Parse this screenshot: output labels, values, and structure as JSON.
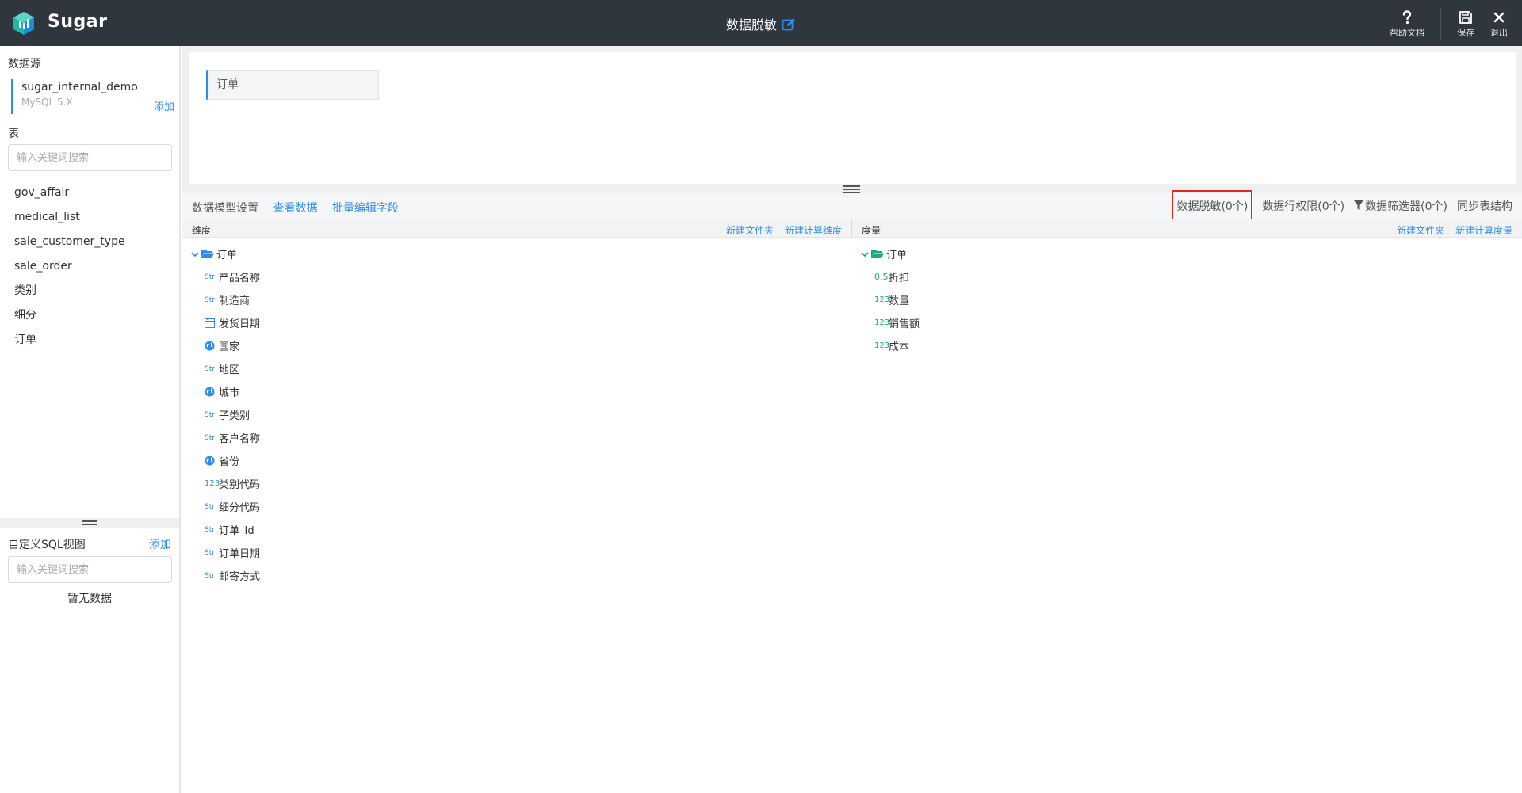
{
  "app": {
    "brand": "Sugar",
    "title": "数据脱敏"
  },
  "top_actions": {
    "help": "帮助文档",
    "save": "保存",
    "exit": "退出"
  },
  "sidebar": {
    "datasource_label": "数据源",
    "datasource": {
      "name": "sugar_internal_demo",
      "type": "MySQL 5.X",
      "add": "添加"
    },
    "tables_label": "表",
    "search_placeholder": "输入关键词搜索",
    "tables": [
      "gov_affair",
      "medical_list",
      "sale_customer_type",
      "sale_order",
      "类别",
      "细分",
      "订单"
    ],
    "sql_label": "自定义SQL视图",
    "sql_add": "添加",
    "sql_search_placeholder": "输入关键词搜索",
    "empty": "暂无数据"
  },
  "canvas": {
    "table_chip": "订单"
  },
  "toolbar": {
    "model_settings": "数据模型设置",
    "view_data": "查看数据",
    "batch_edit": "批量编辑字段",
    "masking": "数据脱敏(0个)",
    "row_permission": "数据行权限(0个)",
    "filter": "数据筛选器(0个)",
    "sync": "同步表结构"
  },
  "dimensions": {
    "header": "维度",
    "new_folder": "新建文件夹",
    "new_calc": "新建计算维度",
    "folder": "订单",
    "fields": [
      {
        "type": "Str",
        "name": "产品名称"
      },
      {
        "type": "Str",
        "name": "制造商"
      },
      {
        "type": "date",
        "name": "发货日期"
      },
      {
        "type": "geo",
        "name": "国家"
      },
      {
        "type": "Str",
        "name": "地区"
      },
      {
        "type": "geo",
        "name": "城市"
      },
      {
        "type": "Str",
        "name": "子类别"
      },
      {
        "type": "Str",
        "name": "客户名称"
      },
      {
        "type": "geo",
        "name": "省份"
      },
      {
        "type": "123",
        "name": "类别代码"
      },
      {
        "type": "Str",
        "name": "细分代码"
      },
      {
        "type": "Str",
        "name": "订单_Id"
      },
      {
        "type": "Str",
        "name": "订单日期"
      },
      {
        "type": "Str",
        "name": "邮寄方式"
      }
    ]
  },
  "measures": {
    "header": "度量",
    "new_folder": "新建文件夹",
    "new_calc": "新建计算度量",
    "folder": "订单",
    "fields": [
      {
        "type": "0.5",
        "name": "折扣"
      },
      {
        "type": "123",
        "name": "数量"
      },
      {
        "type": "123",
        "name": "销售额"
      },
      {
        "type": "123",
        "name": "成本"
      }
    ]
  },
  "colors": {
    "topbar": "#2f363e",
    "accent": "#2d8cf0",
    "highlight": "#e0281e",
    "measure": "#19a97b"
  }
}
